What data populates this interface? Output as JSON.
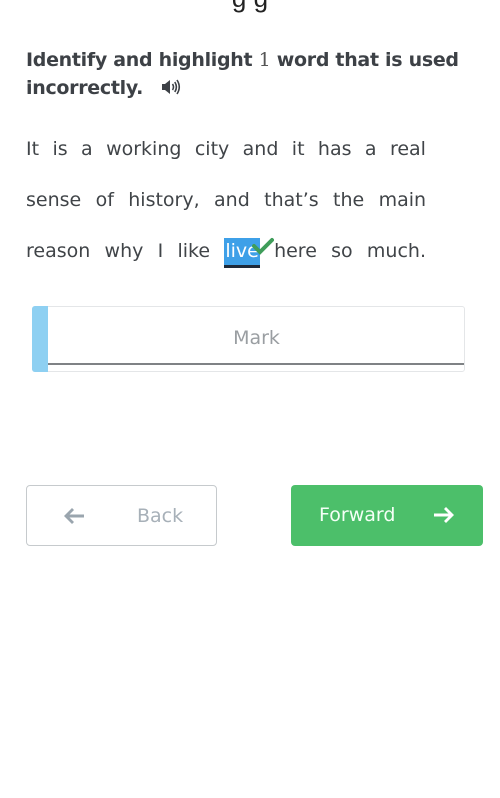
{
  "header": {
    "cut_title": "           g                                  g"
  },
  "question": {
    "instruction_prefix": "Identify and highlight ",
    "instruction_count": "1",
    "instruction_suffix": " word that is used incorrectly.",
    "audio_icon": "speaker-icon"
  },
  "passage": {
    "words_before": [
      "It",
      "is",
      "a",
      "working",
      "city",
      "and",
      "it",
      "has",
      "a",
      "real",
      "sense",
      "of",
      "history,",
      "and",
      "that’s",
      "the",
      "main",
      "reason",
      "why",
      "I",
      "like"
    ],
    "highlighted_word": "live",
    "highlighted_status": "correct",
    "words_after": [
      "here",
      "so",
      "much."
    ]
  },
  "mark": {
    "label": "Mark"
  },
  "nav": {
    "back_label": "Back",
    "back_icon": "arrow-left-icon",
    "forward_label": "Forward",
    "forward_icon": "arrow-right-icon"
  },
  "colors": {
    "highlight": "#3ea0e8",
    "check": "#3f9d5a",
    "forward_button": "#4cbf6a",
    "mark_bar": "#8ed0f2"
  }
}
